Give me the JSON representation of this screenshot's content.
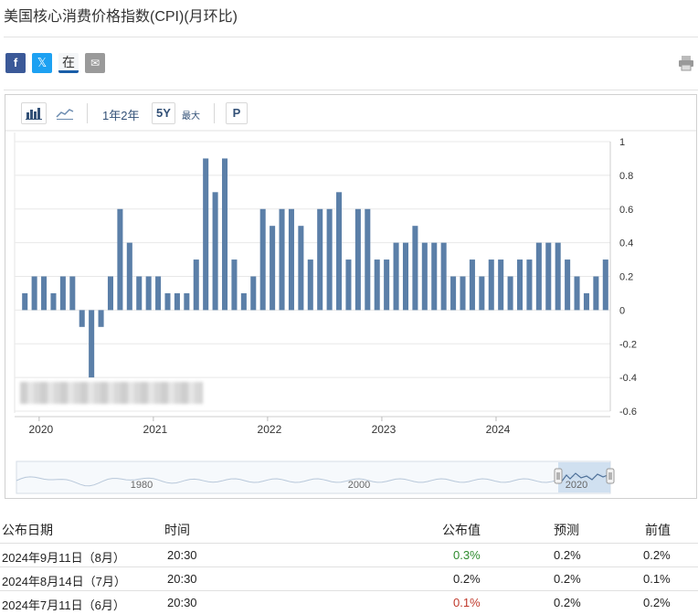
{
  "page": {
    "title": "美国核心消费价格指数(CPI)(月环比)"
  },
  "share": {
    "facebook": "f",
    "twitter": "𝕏",
    "linkedin": "在",
    "email": "✉"
  },
  "toolbar": {
    "range_label": "1年2年",
    "btn_5y": "5Y",
    "btn_max": "最大",
    "btn_p": "P",
    "bar_icon": "bar-chart-icon",
    "line_icon": "line-chart-icon"
  },
  "chart_data": {
    "type": "bar",
    "x": [
      "2019-11",
      "2019-12",
      "2020-01",
      "2020-02",
      "2020-03",
      "2020-04",
      "2020-05",
      "2020-06",
      "2020-07",
      "2020-08",
      "2020-09",
      "2020-10",
      "2020-11",
      "2020-12",
      "2021-01",
      "2021-02",
      "2021-03",
      "2021-04",
      "2021-05",
      "2021-06",
      "2021-07",
      "2021-08",
      "2021-09",
      "2021-10",
      "2021-11",
      "2021-12",
      "2022-01",
      "2022-02",
      "2022-03",
      "2022-04",
      "2022-05",
      "2022-06",
      "2022-07",
      "2022-08",
      "2022-09",
      "2022-10",
      "2022-11",
      "2022-12",
      "2023-01",
      "2023-02",
      "2023-03",
      "2023-04",
      "2023-05",
      "2023-06",
      "2023-07",
      "2023-08",
      "2023-09",
      "2023-10",
      "2023-11",
      "2023-12",
      "2024-01",
      "2024-02",
      "2024-03",
      "2024-04",
      "2024-05",
      "2024-06",
      "2024-07",
      "2024-08"
    ],
    "values": [
      0.1,
      0.2,
      0.2,
      0.1,
      0.2,
      0.2,
      -0.1,
      -0.4,
      -0.1,
      0.2,
      0.6,
      0.4,
      0.2,
      0.2,
      0.2,
      0.1,
      0.1,
      0.1,
      0.3,
      0.9,
      0.7,
      0.9,
      0.3,
      0.1,
      0.2,
      0.6,
      0.5,
      0.6,
      0.6,
      0.5,
      0.3,
      0.6,
      0.6,
      0.7,
      0.3,
      0.6,
      0.6,
      0.3,
      0.3,
      0.4,
      0.4,
      0.5,
      0.4,
      0.4,
      0.4,
      0.2,
      0.2,
      0.3,
      0.2,
      0.3,
      0.3,
      0.2,
      0.3,
      0.3,
      0.4,
      0.4,
      0.4,
      0.3,
      0.2,
      0.1,
      0.2,
      0.3
    ],
    "ylim": [
      -0.6,
      1
    ],
    "yticks": [
      "1",
      "0.8",
      "0.6",
      "0.4",
      "0.2",
      "0",
      "-0.2",
      "-0.4",
      "-0.6"
    ],
    "xticks": [
      "2020",
      "2021",
      "2022",
      "2023",
      "2024"
    ],
    "navigator_ticks": [
      "1980",
      "2000",
      "2020"
    ],
    "grid": true,
    "bar_color": "#5b7fa8",
    "title": "",
    "xlabel": "",
    "ylabel": ""
  },
  "table": {
    "headers": [
      "公布日期",
      "时间",
      "公布值",
      "预测",
      "前值"
    ],
    "rows": [
      {
        "date": "2024年9月11日（8月）",
        "time": "20:30",
        "actual": "0.3%",
        "actual_color": "#2e8b2e",
        "forecast": "0.2%",
        "previous": "0.2%"
      },
      {
        "date": "2024年8月14日（7月）",
        "time": "20:30",
        "actual": "0.2%",
        "actual_color": "#222222",
        "forecast": "0.2%",
        "previous": "0.1%"
      },
      {
        "date": "2024年7月11日（6月）",
        "time": "20:30",
        "actual": "0.1%",
        "actual_color": "#c0392b",
        "forecast": "0.2%",
        "previous": "0.2%"
      }
    ]
  }
}
